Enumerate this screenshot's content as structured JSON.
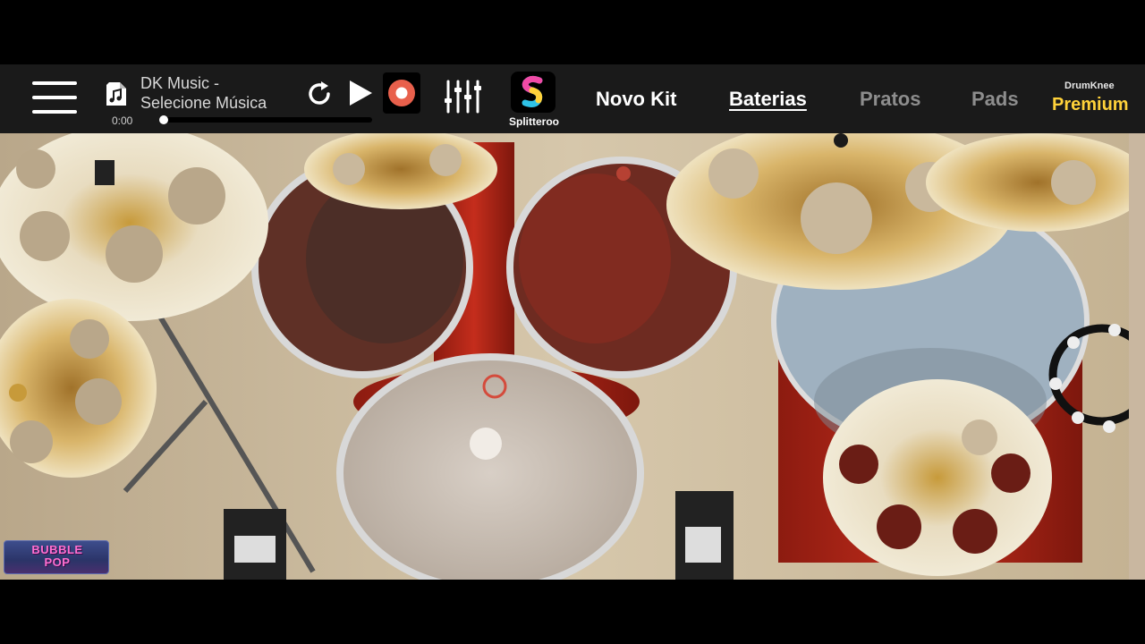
{
  "toolbar": {
    "music": {
      "title_line1": "DK Music -",
      "title_line2": "Selecione Música",
      "time": "0:00",
      "progress_fraction": 0.0
    },
    "splitteroo_label": "Splitteroo",
    "nav": {
      "novo_kit": "Novo Kit",
      "baterias": "Baterias",
      "pratos": "Pratos",
      "pads": "Pads"
    },
    "premium": {
      "brand": "DrumKnee",
      "label": "Premium"
    }
  },
  "overlay": {
    "logo_line1": "BUBBLE",
    "logo_line2": "POP"
  },
  "icons": {
    "menu": "hamburger-menu-icon",
    "music": "music-file-icon",
    "repeat": "repeat-icon",
    "play": "play-icon",
    "record": "record-icon",
    "mixer": "mixer-sliders-icon",
    "splitteroo": "splitteroo-logo-icon"
  },
  "colors": {
    "toolbar_bg": "#1a1a1a",
    "premium": "#ffd23a",
    "record": "#e8604c",
    "nav_active": "#ffffff",
    "nav_inactive": "#8d8d8d",
    "drum_shell": "#b8281a",
    "wall": "#c9b89c"
  }
}
